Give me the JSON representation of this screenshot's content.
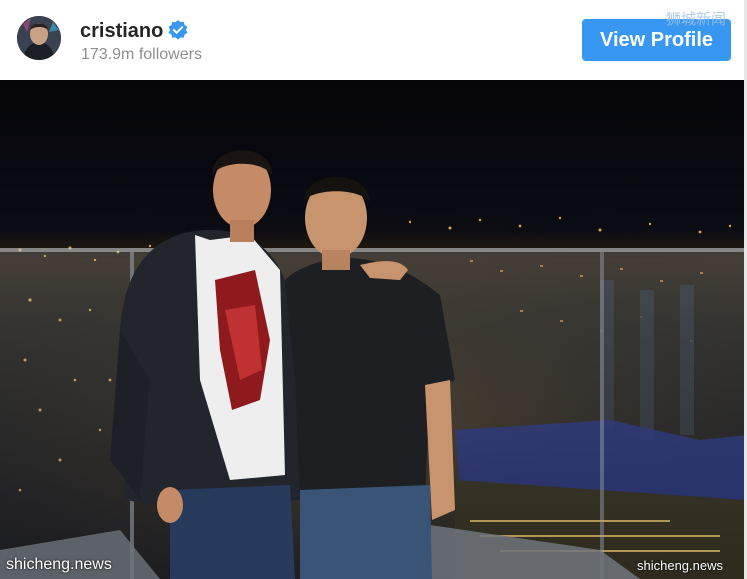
{
  "post_header": {
    "username": "cristiano",
    "followers": "173.9m followers",
    "view_profile_label": "View Profile",
    "verified_icon": "verified-badge-icon",
    "accent_color": "#3897f0"
  },
  "watermarks": {
    "top_right": "狮城新闻",
    "bottom_left": "shicheng.news",
    "bottom_right": "shicheng.news"
  }
}
